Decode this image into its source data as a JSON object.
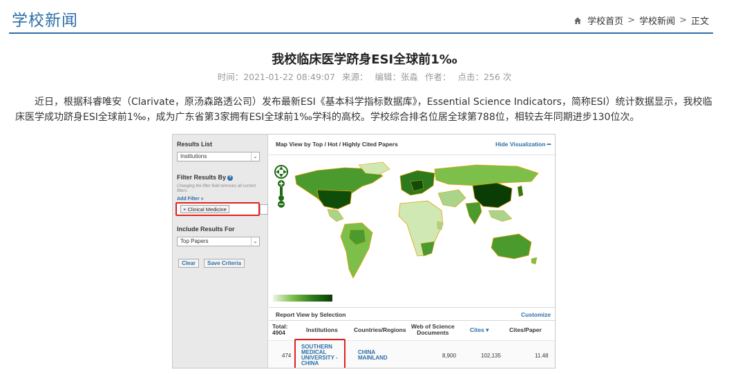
{
  "header": {
    "section_title": "学校新闻",
    "breadcrumb": {
      "home": "学校首页",
      "sep1": ">",
      "news": "学校新闻",
      "sep2": ">",
      "current": "正文"
    }
  },
  "article": {
    "title": "我校临床医学跻身ESI全球前1‰",
    "meta": {
      "time": "时间：2021-01-22 08:49:07",
      "source": "来源：",
      "editor": "编辑：张淼",
      "author": "作者：",
      "clicks": "点击：256 次"
    },
    "body": "近日，根据科睿唯安（Clarivate，原汤森路透公司）发布最新ESI《基本科学指标数据库》，Essential Science Indicators，简称ESI）统计数据显示，我校临床医学成功跻身ESI全球前1‰，成为广东省第3家拥有ESI全球前1‰学科的高校。学校综合排名位居全球第788位，相较去年同期进步130位次。"
  },
  "screenshot": {
    "left_panel": {
      "results_list_label": "Results List",
      "results_list_value": "Institutions",
      "filter_label": "Filter Results By",
      "filter_note": "Changing the filter field removes all current filters.",
      "add_filter": "Add Filter »",
      "filter_tag": "× Clinical Medicine",
      "include_label": "Include Results For",
      "include_value": "Top Papers",
      "clear_button": "Clear",
      "save_button": "Save Criteria"
    },
    "map": {
      "title": "Map View by Top / Hot / Highly Cited Papers",
      "hide_link": "Hide Visualization ━"
    },
    "report": {
      "title": "Report View by Selection",
      "customize": "Customize",
      "columns": {
        "total": "Total:\n4904",
        "institutions": "Institutions",
        "countries": "Countries/Regions",
        "wos_docs": "Web of Science\nDocuments",
        "cites": "Cites ▾",
        "cites_per_paper": "Cites/Paper"
      },
      "row": {
        "rank": "474",
        "institution": "SOUTHERN\nMEDICAL\nUNIVERSITY -\nCHINA",
        "country": "CHINA\nMAINLAND",
        "docs": "8,900",
        "cites": "102,135",
        "cites_per_paper": "11.48"
      }
    }
  },
  "colors": {
    "accent": "#2c6ea8",
    "highlight_box": "#e02020",
    "map_dark": "#0a3d06",
    "map_mid": "#4a9a2e",
    "map_light": "#cfe8b4"
  }
}
